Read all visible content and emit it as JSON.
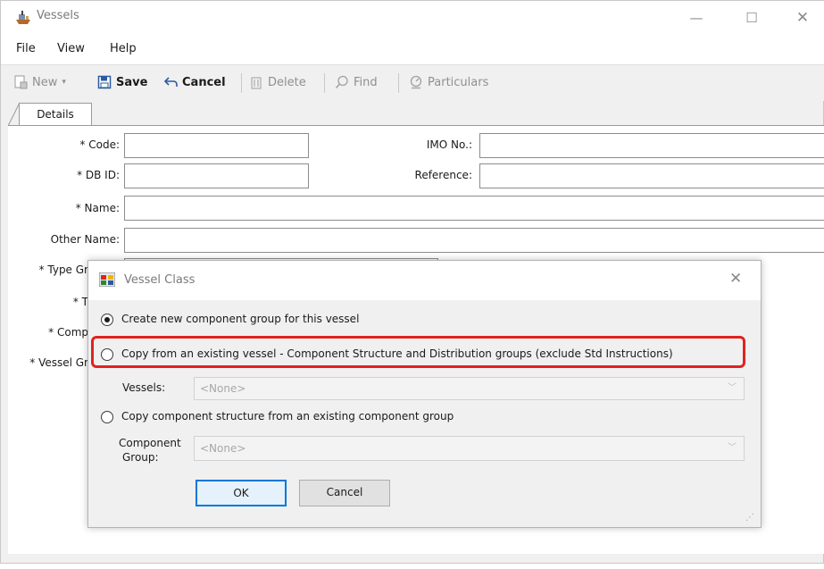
{
  "window": {
    "title": "Vessels",
    "controls": {
      "minimize": "—",
      "maximize": "☐",
      "close": "✕"
    }
  },
  "menu": {
    "file": "File",
    "view": "View",
    "help": "Help"
  },
  "toolbar": {
    "new": "New",
    "new_arrow": "▾",
    "save": "Save",
    "cancel": "Cancel",
    "delete": "Delete",
    "find": "Find",
    "particulars": "Particulars"
  },
  "tabs": {
    "details": "Details"
  },
  "form": {
    "code": "* Code:",
    "db_id": "* DB ID:",
    "name": "* Name:",
    "other_name": "Other Name:",
    "imo_no": "IMO No.:",
    "reference": "Reference:",
    "type_group_partial": "* Type Gr",
    "t_partial": "* T",
    "comp_partial": "* Comp",
    "vessel_group_partial": "* Vessel Gr"
  },
  "dialog": {
    "title": "Vessel Class",
    "close": "✕",
    "options": {
      "create_new": "Create new component group for this vessel",
      "copy_vessel": "Copy from an existing vessel - Component Structure and Distribution groups (exclude Std Instructions)",
      "copy_component": "Copy component structure from an existing component group"
    },
    "selected_option": "create_new",
    "vessels_label": "Vessels:",
    "vessels_value": "<None>",
    "component_group_label_1": "Component",
    "component_group_label_2": "Group:",
    "component_group_value": "<None>",
    "ok": "OK",
    "cancel": "Cancel",
    "highlight_color": "#e0231f"
  }
}
